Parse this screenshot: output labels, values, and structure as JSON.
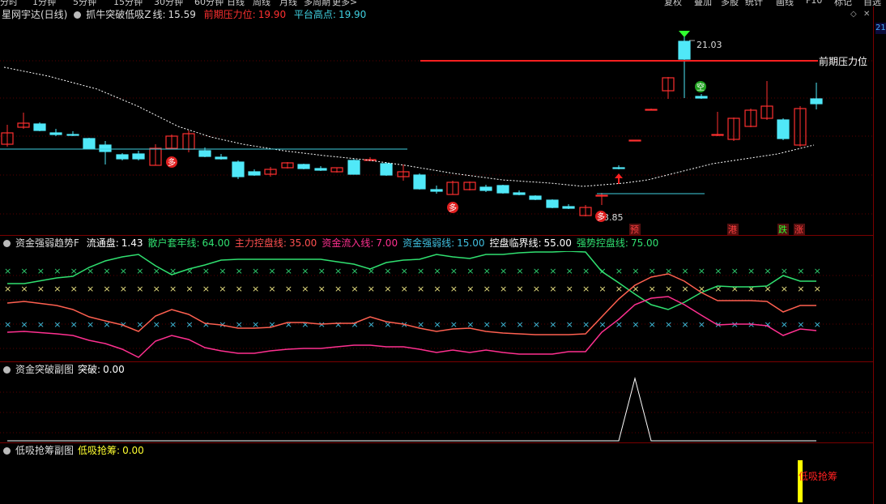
{
  "top_nav": [
    "分时",
    "1分钟",
    "5分钟",
    "15分钟",
    "30分钟",
    "60分钟",
    "日线",
    "周线",
    "月线",
    "多周期",
    "更多>",
    "复权",
    "叠加",
    "多股",
    "统计",
    "画线",
    "F10",
    "标记",
    "自选"
  ],
  "main": {
    "title": "星网宇达(日线)",
    "indicator": "抓牛突破低吸Z",
    "line_label": "线:",
    "line_value": "15.59",
    "pressure_label": "前期压力位:",
    "pressure_value": "19.90",
    "platform_label": "平台高点:",
    "platform_value": "19.90",
    "high_label": "21.03",
    "low_label": "13.85",
    "pressure_tag": "前期压力位",
    "right_tag": "21",
    "markers": {
      "duo1": "多",
      "duo2": "多",
      "duo3": "多",
      "kong": "空"
    },
    "bottom_tags": [
      {
        "text": "预",
        "color": "#ff4040"
      },
      {
        "text": "港",
        "color": "#ff4040"
      },
      {
        "text": "跌",
        "color": "#30ff30"
      },
      {
        "text": "涨",
        "color": "#ff4040"
      }
    ]
  },
  "panel2": {
    "title": "资金强弱趋势F",
    "items": [
      {
        "label": "流通盘:",
        "value": "1.43",
        "color": "#ffffff"
      },
      {
        "label": "散户套牢线:",
        "value": "64.00",
        "color": "#30e070"
      },
      {
        "label": "主力控盘线:",
        "value": "35.00",
        "color": "#ff5050"
      },
      {
        "label": "资金流入线:",
        "value": "7.00",
        "color": "#ff3090"
      },
      {
        "label": "资金强弱线:",
        "value": "15.00",
        "color": "#40c0e0"
      },
      {
        "label": "控盘临界线:",
        "value": "55.00",
        "color": "#ffffff"
      },
      {
        "label": "强势控盘线:",
        "value": "75.00",
        "color": "#30e070"
      }
    ]
  },
  "panel3": {
    "title": "资金突破副图",
    "label": "突破:",
    "value": "0.00"
  },
  "panel4": {
    "title": "低吸抢筹副图",
    "label": "低吸抢筹:",
    "value": "0.00",
    "bar_label": "低吸抢筹"
  },
  "colors": {
    "up": "#ff3030",
    "down": "#50e8f8",
    "separator": "#7a0000",
    "ma": "#ffffff"
  }
}
